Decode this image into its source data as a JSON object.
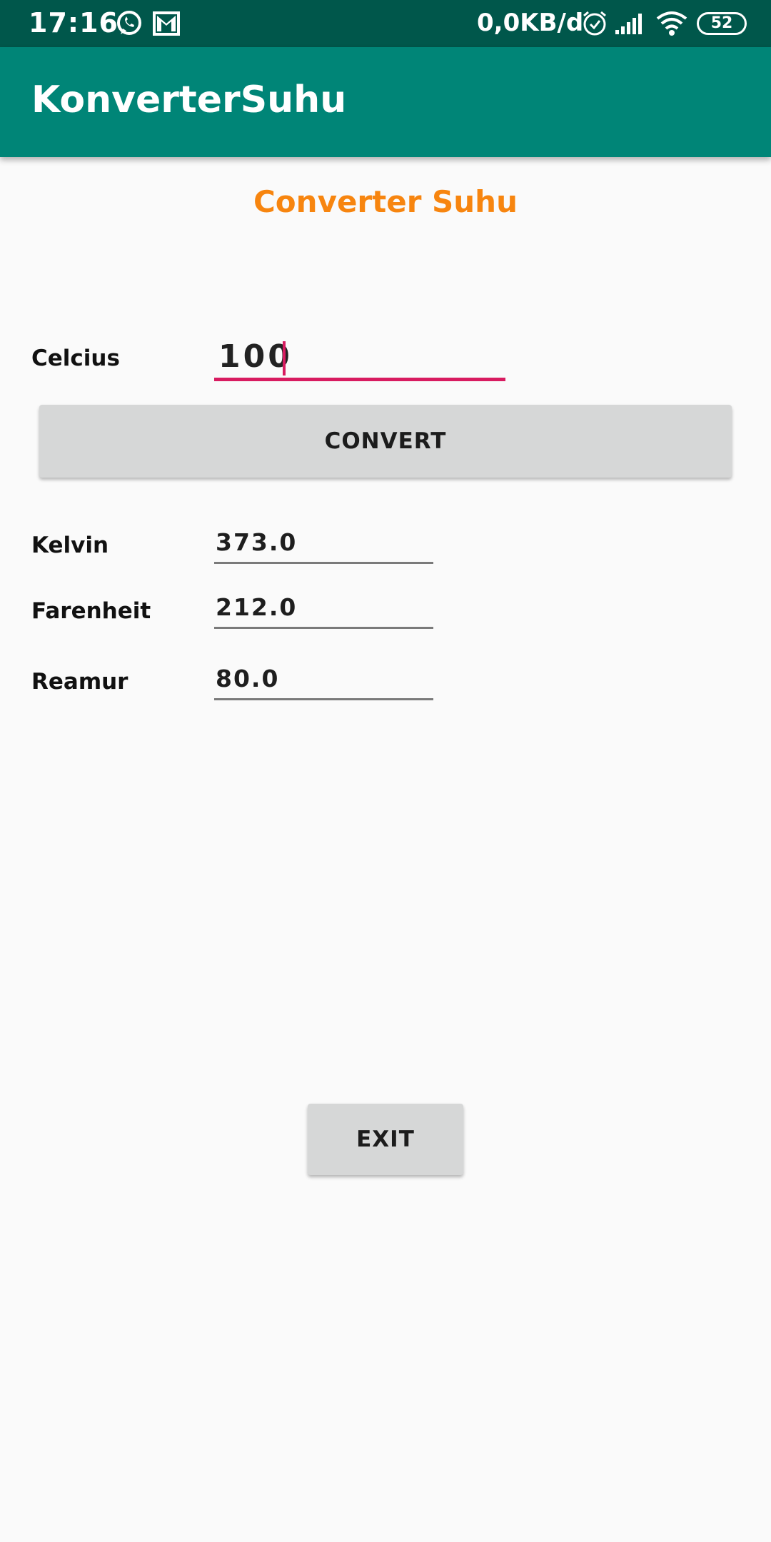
{
  "status_bar": {
    "time": "17:16",
    "data_speed": "0,0KB/d",
    "battery_level": "52",
    "icons": [
      "whatsapp-icon",
      "gmail-icon",
      "alarm-icon",
      "signal-icon",
      "wifi-icon",
      "battery-icon"
    ]
  },
  "app_bar": {
    "title": "KonverterSuhu"
  },
  "main": {
    "heading": "Converter Suhu",
    "celcius": {
      "label": "Celcius",
      "value": "100"
    },
    "convert_button": "CONVERT",
    "results": [
      {
        "label": "Kelvin",
        "value": "373.0"
      },
      {
        "label": "Farenheit",
        "value": "212.0"
      },
      {
        "label": "Reamur",
        "value": "80.0"
      }
    ],
    "exit_button": "EXIT"
  },
  "colors": {
    "status_bar": "#00574b",
    "app_bar": "#008577",
    "accent": "#d81b60",
    "heading": "#f7850f",
    "button": "#d6d7d7"
  }
}
